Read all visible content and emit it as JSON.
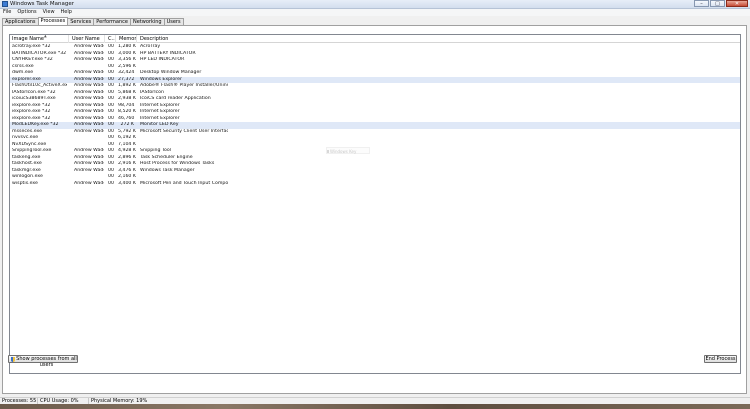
{
  "window": {
    "title": "Windows Task Manager",
    "controls": {
      "minimize": "–",
      "maximize": "□",
      "close": "✕"
    }
  },
  "menu": [
    "File",
    "Options",
    "View",
    "Help"
  ],
  "tabs": [
    "Applications",
    "Processes",
    "Services",
    "Performance",
    "Networking",
    "Users"
  ],
  "active_tab": "Processes",
  "columns": {
    "name": "Image Name",
    "user": "User Name",
    "cpu": "C...",
    "mem": "Memor...",
    "desc": "Description"
  },
  "processes": [
    {
      "name": "acrotray.exe *32",
      "user": "Andrew Wade",
      "cpu": "00",
      "mem": "1,280 K",
      "desc": "AcroTray"
    },
    {
      "name": "BATINDICATOR.exe *32",
      "user": "Andrew Wade",
      "cpu": "00",
      "mem": "3,000 K",
      "desc": "HP BATTERY INDICATOR"
    },
    {
      "name": "CNYHKEY.exe *32",
      "user": "Andrew Wade",
      "cpu": "00",
      "mem": "3,356 K",
      "desc": "HP LED INDICATOR"
    },
    {
      "name": "csrss.exe",
      "user": "",
      "cpu": "00",
      "mem": "2,596 K",
      "desc": ""
    },
    {
      "name": "dwm.exe",
      "user": "Andrew Wade",
      "cpu": "00",
      "mem": "32,424 K",
      "desc": "Desktop Window Manager"
    },
    {
      "name": "explorer.exe",
      "user": "Andrew Wade",
      "cpu": "00",
      "mem": "27,372 K",
      "desc": "Windows Explorer"
    },
    {
      "name": "FlashUtil10c_ActiveX.exe *32",
      "user": "Andrew Wade",
      "cpu": "00",
      "mem": "1,892 K",
      "desc": "Adobe® Flash® Player Installer/Uninstaller 11.0 r1"
    },
    {
      "name": "IAStorIcon.exe *32",
      "user": "Andrew Wade",
      "cpu": "00",
      "mem": "5,868 K",
      "desc": "IAStorIcon"
    },
    {
      "name": "icoiucS38689T.exe",
      "user": "Andrew Wade",
      "cpu": "00",
      "mem": "2,938 K",
      "desc": "IcoiCS card reader Application"
    },
    {
      "name": "iexplore.exe *32",
      "user": "Andrew Wade",
      "cpu": "00",
      "mem": "98,704 K",
      "desc": "Internet Explorer"
    },
    {
      "name": "iexplore.exe *32",
      "user": "Andrew Wade",
      "cpu": "00",
      "mem": "8,520 K",
      "desc": "Internet Explorer"
    },
    {
      "name": "iexplore.exe *32",
      "user": "Andrew Wade",
      "cpu": "00",
      "mem": "46,760 K",
      "desc": "Internet Explorer"
    },
    {
      "name": "ModLEDKey.exe *32",
      "user": "Andrew Wade",
      "cpu": "00",
      "mem": "272 K",
      "desc": "Monitor LED Key"
    },
    {
      "name": "msseces.exe",
      "user": "Andrew Wade",
      "cpu": "00",
      "mem": "5,792 K",
      "desc": "Microsoft Security Client User Interface"
    },
    {
      "name": "nvvsvc.exe",
      "user": "",
      "cpu": "00",
      "mem": "6,192 K",
      "desc": ""
    },
    {
      "name": "NvXDSync.exe",
      "user": "",
      "cpu": "00",
      "mem": "7,104 K",
      "desc": ""
    },
    {
      "name": "SnippingTool.exe",
      "user": "Andrew Wade",
      "cpu": "00",
      "mem": "4,928 K",
      "desc": "Snipping Tool"
    },
    {
      "name": "taskeng.exe",
      "user": "Andrew Wade",
      "cpu": "00",
      "mem": "2,896 K",
      "desc": "Task Scheduler Engine"
    },
    {
      "name": "taskhost.exe",
      "user": "Andrew Wade",
      "cpu": "00",
      "mem": "2,916 K",
      "desc": "Host Process for Windows Tasks"
    },
    {
      "name": "taskmgr.exe",
      "user": "Andrew Wade",
      "cpu": "00",
      "mem": "3,476 K",
      "desc": "Windows Task Manager"
    },
    {
      "name": "winlogon.exe",
      "user": "",
      "cpu": "00",
      "mem": "2,160 K",
      "desc": ""
    },
    {
      "name": "wisptis.exe",
      "user": "Andrew Wade",
      "cpu": "00",
      "mem": "3,400 K",
      "desc": "Microsoft Pen and Touch Input Component"
    }
  ],
  "highlighted_rows": [
    5,
    12
  ],
  "tooltip": "Windows Key",
  "buttons": {
    "show_all": "Show processes from all users",
    "end_process": "End Process"
  },
  "status": {
    "processes": "Processes: 55",
    "cpu": "CPU Usage: 0%",
    "memory": "Physical Memory: 19%"
  }
}
